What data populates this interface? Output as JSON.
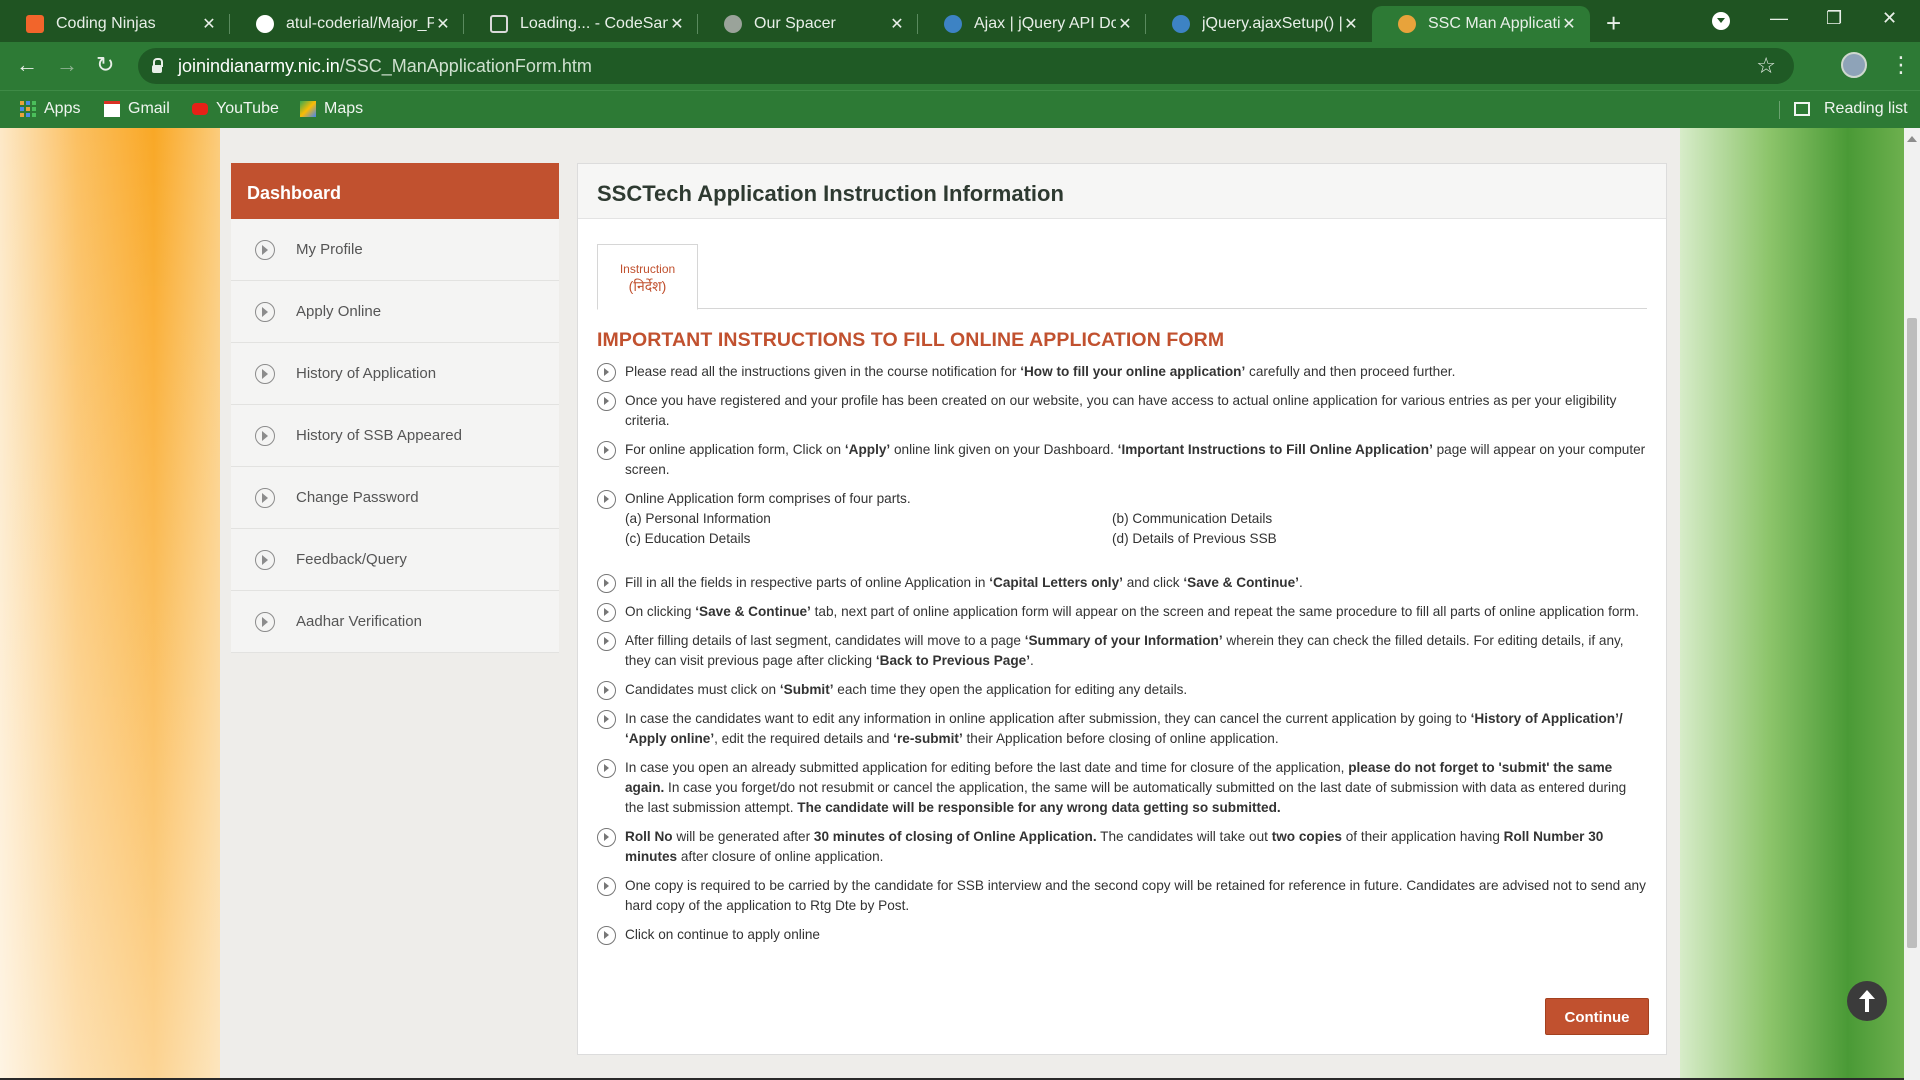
{
  "browser": {
    "tabs": [
      {
        "title": "Coding Ninjas",
        "favicon_color": "#f2652b",
        "icon": "coding-ninjas-icon"
      },
      {
        "title": "atul-coderial/Major_P",
        "favicon_color": "#ffffff",
        "icon": "github-icon"
      },
      {
        "title": "Loading... - CodeSand",
        "favicon_color": "#d9d9d9",
        "icon": "codesandbox-icon"
      },
      {
        "title": "Our Spacer",
        "favicon_color": "#9aa39a",
        "icon": "globe-icon"
      },
      {
        "title": "Ajax | jQuery API Docu",
        "favicon_color": "#3d83c4",
        "icon": "jquery-icon"
      },
      {
        "title": "jQuery.ajaxSetup() | jQ",
        "favicon_color": "#3d83c4",
        "icon": "jquery-icon"
      },
      {
        "title": "SSC Man Application I",
        "favicon_color": "#e8a33b",
        "icon": "army-icon"
      }
    ],
    "active_tab": 6,
    "new_tab": "+",
    "url_domain": "joinindianarmy.nic.in",
    "url_path": "/SSC_ManApplicationForm.htm",
    "bookmarks": [
      "Apps",
      "Gmail",
      "YouTube",
      "Maps"
    ],
    "reading_list": "Reading list"
  },
  "sidebar": {
    "title": "Dashboard",
    "items": [
      "My Profile",
      "Apply Online",
      "History of Application",
      "History of SSB Appeared",
      "Change Password",
      "Feedback/Query",
      "Aadhar Verification"
    ]
  },
  "panel": {
    "title": "SSCTech Application Instruction Information",
    "tab_label_en": "Instruction",
    "tab_label_hi": "(निर्देश)",
    "heading": "IMPORTANT INSTRUCTIONS TO FILL ONLINE APPLICATION FORM",
    "parts": [
      "(a) Personal Information",
      "(b) Communication Details",
      "(c) Education Details",
      "(d) Details of Previous SSB"
    ],
    "continue_label": "Continue"
  },
  "colors": {
    "accent": "#c1512f",
    "chrome_green": "#2d7a35",
    "chrome_dark": "#1f5422"
  }
}
